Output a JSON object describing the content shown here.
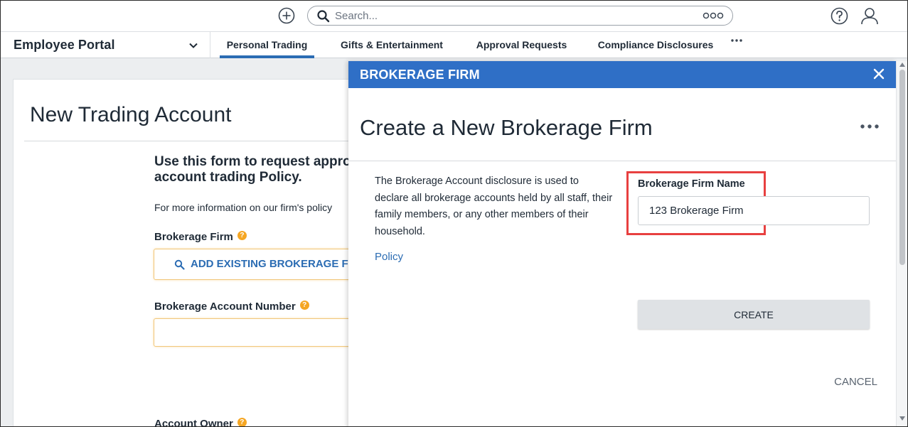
{
  "topbar": {
    "search_placeholder": "Search...",
    "icons": [
      "plus-circle-icon",
      "search-icon",
      "more-options-icon",
      "help-icon",
      "user-icon"
    ]
  },
  "nav": {
    "portal_label": "Employee Portal",
    "tabs": [
      {
        "label": "Personal Trading",
        "active": true
      },
      {
        "label": "Gifts & Entertainment",
        "active": false
      },
      {
        "label": "Approval Requests",
        "active": false
      },
      {
        "label": "Compliance Disclosures",
        "active": false
      }
    ]
  },
  "page": {
    "title": "New Trading Account",
    "intro": "Use this form to request appro account trading Policy.",
    "more_info": "For more information on our firm's policy",
    "brokerage_firm_label": "Brokerage Firm",
    "add_existing_label": "ADD EXISTING BROKERAGE FI",
    "account_number_label": "Brokerage Account Number",
    "account_owner_label": "Account Owner"
  },
  "drawer": {
    "header": "BROKERAGE FIRM",
    "title": "Create a New Brokerage Firm",
    "description": "The Brokerage Account disclosure is used to declare all brokerage accounts held by all staff, their family members, or any other members of their household.",
    "policy_link": "Policy",
    "firm_name_label": "Brokerage Firm Name",
    "firm_name_value": "123 Brokerage Firm",
    "create_label": "CREATE",
    "cancel_label": "CANCEL"
  },
  "colors": {
    "accent": "#2f6fc6",
    "link": "#2b6cb3",
    "highlight": "#e84040",
    "help_badge": "#f5a623"
  }
}
